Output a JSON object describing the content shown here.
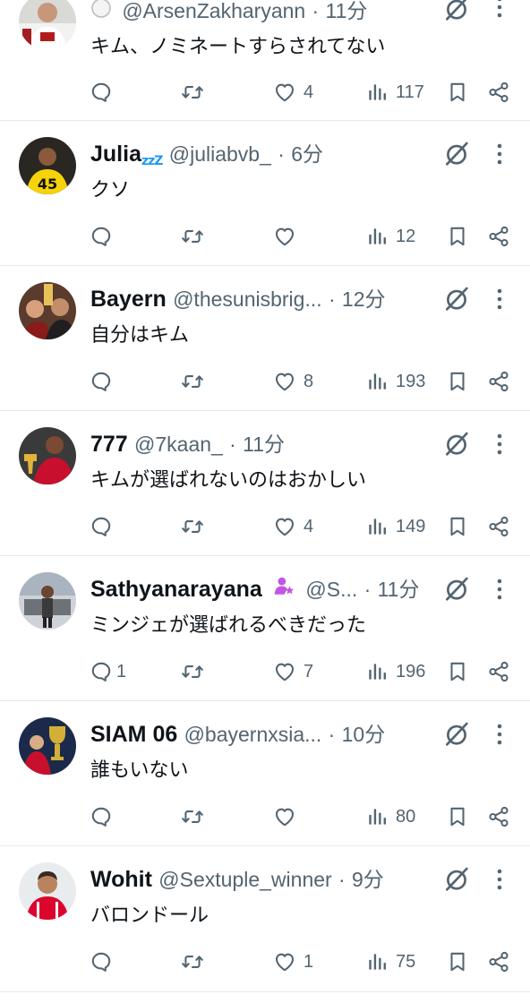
{
  "colors": {
    "text": "#0f1419",
    "secondary": "#536471",
    "divider": "#e6e8ea",
    "zzz": "#1d9bf0",
    "badge": "#c254e6"
  },
  "tweets": [
    {
      "name": "",
      "badge": "white-circle-emoji",
      "handle": "@ArsenZakharyann",
      "time": "11分",
      "text": "キム、ノミネートすらされてない",
      "replies": "",
      "likes": "4",
      "views": "117"
    },
    {
      "name": "Julia",
      "name_suffix": "zzZ",
      "handle": "@juliabvb_",
      "time": "6分",
      "text": "クソ",
      "replies": "",
      "likes": "",
      "views": "12"
    },
    {
      "name": "Bayern",
      "handle": "@thesunisbrig...",
      "time": "12分",
      "text": "自分はキム",
      "replies": "",
      "likes": "8",
      "views": "193"
    },
    {
      "name": "777",
      "handle": "@7kaan_",
      "time": "11分",
      "text": "キムが選ばれないのはおかしい",
      "replies": "",
      "likes": "4",
      "views": "149"
    },
    {
      "name": "Sathyanarayana",
      "badge": "person-star-emoji",
      "handle": "@S...",
      "time": "11分",
      "text": "ミンジェが選ばれるべきだった",
      "replies": "1",
      "likes": "7",
      "views": "196"
    },
    {
      "name": "SIAM 06",
      "handle": "@bayernxsia...",
      "time": "10分",
      "text": "誰もいない",
      "replies": "",
      "likes": "",
      "views": "80"
    },
    {
      "name": "Wohit",
      "handle": "@Sextuple_winner",
      "time": "9分",
      "text": "バロンドール",
      "replies": "",
      "likes": "1",
      "views": "75"
    }
  ],
  "sep": "·",
  "icons": [
    "reply-icon",
    "repost-icon",
    "like-icon",
    "views-icon",
    "bookmark-icon",
    "share-icon",
    "grok-icon",
    "more-icon"
  ]
}
